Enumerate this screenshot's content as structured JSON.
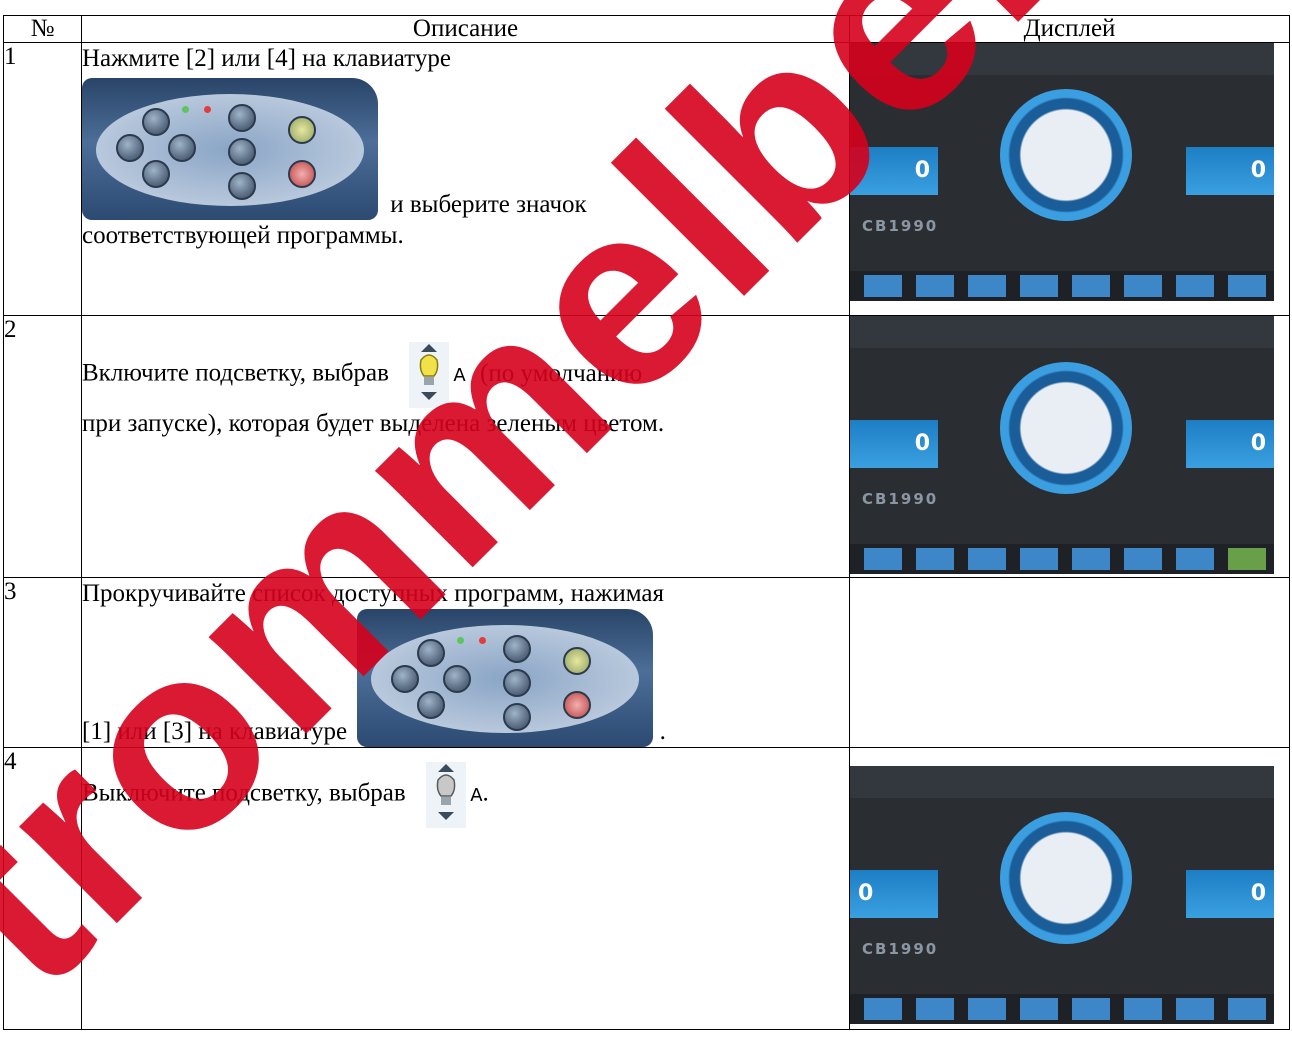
{
  "table": {
    "headers": [
      "№",
      "Описание",
      "Дисплей"
    ],
    "rows": [
      {
        "num": "1",
        "text_a": "Нажмите [2] или [4] на клавиатуре",
        "text_b": "и выберите значок",
        "text_c": "соответствующей программы."
      },
      {
        "num": "2",
        "text_a": "Включите подсветку, выбрав",
        "text_b": "(по умолчанию",
        "text_c": "при запуске), которая будет выделена зеленым цветом."
      },
      {
        "num": "3",
        "text_a": "Прокручивайте список доступных программ, нажимая",
        "text_b": "[1] или [3] на клавиатуре",
        "text_c": "."
      },
      {
        "num": "4",
        "text_a": "Выключите подсветку, выбрав",
        "text_b": "."
      }
    ]
  },
  "lamp_label": "A",
  "display": {
    "left_value": "0",
    "right_value": "0",
    "code": "CB1990"
  },
  "watermark": "trommelberg",
  "colors": {
    "display_bg": "#2a2e33",
    "display_accent": "#3aa0e0",
    "lamp_on": "#f2e24a",
    "lamp_off": "#c8c8c8",
    "active_icon": "#6a9f4a"
  }
}
